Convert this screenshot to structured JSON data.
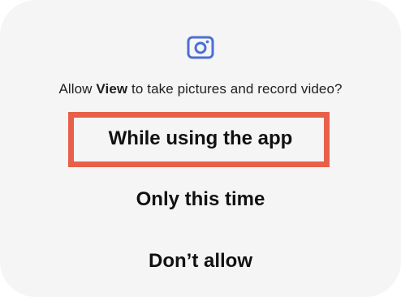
{
  "dialog": {
    "icon": "camera-icon",
    "accent_color": "#4a6fd6",
    "prompt": {
      "prefix": "Allow ",
      "app_name": "View",
      "suffix": " to take pictures and record video?"
    },
    "options": [
      {
        "label": "While using the app",
        "highlighted": true
      },
      {
        "label": "Only this time",
        "highlighted": false
      },
      {
        "label": "Don’t allow",
        "highlighted": false
      }
    ],
    "highlight_color": "#e8604a"
  }
}
